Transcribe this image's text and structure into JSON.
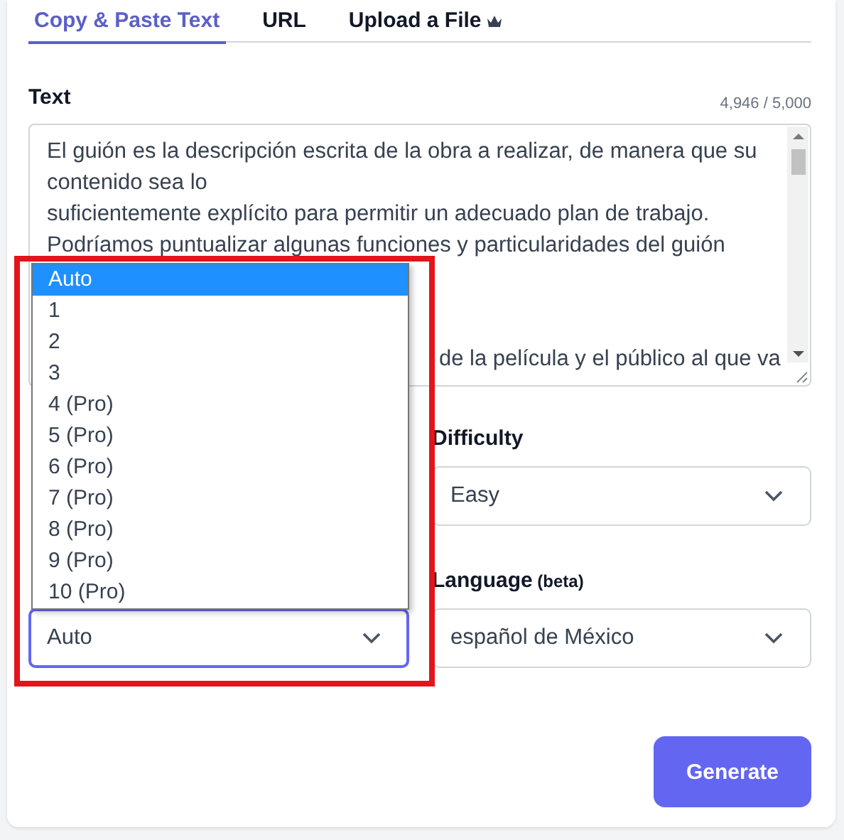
{
  "tabs": [
    {
      "label": "Copy & Paste Text",
      "selected": true,
      "premium": false
    },
    {
      "label": "URL",
      "selected": false,
      "premium": false
    },
    {
      "label": "Upload a File",
      "selected": false,
      "premium": true
    }
  ],
  "text_field": {
    "label": "Text",
    "counter": "4,946 / 5,000",
    "lines": [
      "El guión es la descripción escrita de la obra a realizar, de manera que su",
      "contenido sea lo",
      "suficientemente explícito para permitir un adecuado plan de trabajo.",
      "Podríamos puntualizar algunas funciones y particularidades del guión"
    ],
    "cut_line": "de la película y el público al que va"
  },
  "dropdown": {
    "options": [
      {
        "label": "Auto",
        "selected": true
      },
      {
        "label": "1",
        "selected": false
      },
      {
        "label": "2",
        "selected": false
      },
      {
        "label": "3",
        "selected": false
      },
      {
        "label": "4 (Pro)",
        "selected": false
      },
      {
        "label": "5 (Pro)",
        "selected": false
      },
      {
        "label": "6 (Pro)",
        "selected": false
      },
      {
        "label": "7 (Pro)",
        "selected": false
      },
      {
        "label": "8 (Pro)",
        "selected": false
      },
      {
        "label": "9 (Pro)",
        "selected": false
      },
      {
        "label": "10 (Pro)",
        "selected": false
      }
    ]
  },
  "count_select": {
    "value": "Auto",
    "focused": true
  },
  "difficulty": {
    "label": "Difficulty",
    "value": "Easy"
  },
  "language": {
    "label": "Language",
    "label_note": "(beta)",
    "value": "español de México"
  },
  "generate_button": "Generate"
}
